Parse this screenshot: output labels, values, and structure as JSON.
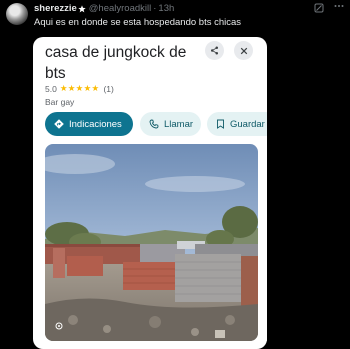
{
  "post": {
    "display_name": "sherezzie",
    "handle": "@healyroadkill",
    "separator": "·",
    "time": "13h",
    "text": "Aqui es en donde se esta hospedando bts chicas"
  },
  "card": {
    "title": "casa de jungkock de bts",
    "rating_value": "5.0",
    "stars": "★★★★★",
    "review_count": "(1)",
    "category": "Bar gay",
    "actions": {
      "directions": "Indicaciones",
      "call": "Llamar",
      "save": "Guardar"
    }
  },
  "colors": {
    "background": "#000000",
    "primary_action": "#0e7490",
    "secondary_action": "#e4f2f3",
    "stars": "#fbbc04"
  },
  "icons": {
    "grok": "grok-icon",
    "more": "more-icon",
    "share": "share-icon",
    "close": "close-icon",
    "directions": "directions-icon",
    "call": "phone-icon",
    "save": "bookmark-icon"
  }
}
